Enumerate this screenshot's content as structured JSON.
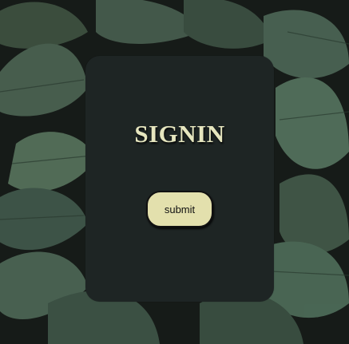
{
  "form": {
    "title": "SIGNIN",
    "submit_label": "submit"
  },
  "colors": {
    "card_bg": "#1e2524",
    "title_color": "#e6e6bf",
    "button_bg": "#e3e0ad",
    "leaf_green": "#4f6652",
    "background_dark": "#1a1f1c"
  },
  "background": {
    "icon": "leaves-photo"
  }
}
